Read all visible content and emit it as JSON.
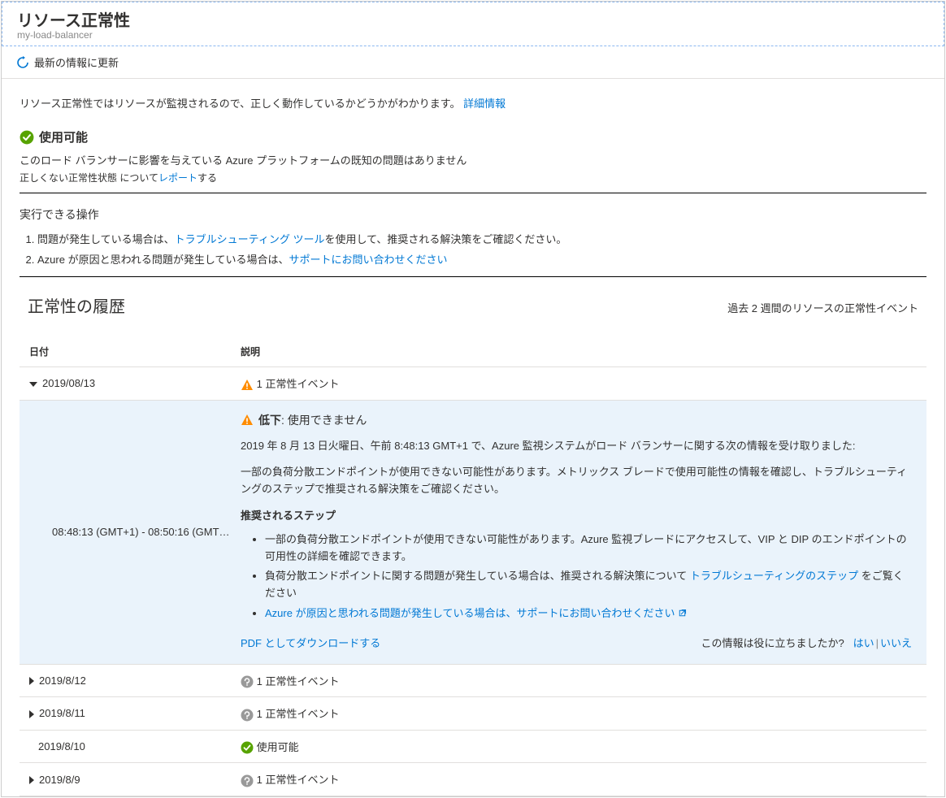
{
  "header": {
    "title": "リソース正常性",
    "subtitle": "my-load-balancer"
  },
  "cmdbar": {
    "refresh": "最新の情報に更新"
  },
  "intro": {
    "text": "リソース正常性ではリソースが監視されるので、正しく動作しているかどうかがわかります。",
    "link": "詳細情報"
  },
  "status": {
    "label": "使用可能",
    "desc": "このロード バランサーに影響を与えている Azure プラットフォームの既知の問題はありません",
    "wrong_prefix": "正しくない正常性状態 について",
    "wrong_link": "レポート",
    "wrong_suffix": "する"
  },
  "actions": {
    "title": "実行できる操作",
    "items": [
      {
        "pre": "問題が発生している場合は、",
        "link": "トラブルシューティング ツール",
        "post": "を使用して、推奨される解決策をご確認ください。"
      },
      {
        "pre": "Azure が原因と思われる問題が発生している場合は、",
        "link": "サポートにお問い合わせください",
        "post": ""
      }
    ]
  },
  "history": {
    "title": "正常性の履歴",
    "subtitle": "過去 2 週間のリソースの正常性イベント",
    "cols": {
      "date": "日付",
      "desc": "説明"
    },
    "rows": [
      {
        "date": "2019/08/13",
        "desc": "1 正常性イベント",
        "icon": "warn",
        "expanded": true
      },
      {
        "date": "2019/8/12",
        "desc": "1 正常性イベント",
        "icon": "unknown"
      },
      {
        "date": "2019/8/11",
        "desc": "1 正常性イベント",
        "icon": "unknown"
      },
      {
        "date": "2019/8/10",
        "desc": "使用可能",
        "icon": "ok",
        "nocaret": true
      },
      {
        "date": "2019/8/9",
        "desc": "1 正常性イベント",
        "icon": "unknown"
      }
    ]
  },
  "detail": {
    "time": "08:48:13 (GMT+1) - 08:50:16 (GMT…",
    "status_label": "低下",
    "status_text": ": 使用できません",
    "line1": "2019 年 8 月 13 日火曜日、午前 8:48:13 GMT+1 で、Azure 監視システムがロード バランサーに関する次の情報を受け取りました:",
    "line2": "一部の負荷分散エンドポイントが使用できない可能性があります。メトリックス ブレードで使用可能性の情報を確認し、トラブルシューティングのステップで推奨される解決策をご確認ください。",
    "steps_title": "推奨されるステップ",
    "steps": [
      {
        "text": "一部の負荷分散エンドポイントが使用できない可能性があります。Azure 監視ブレードにアクセスして、VIP と DIP のエンドポイントの可用性の詳細を確認できます。"
      },
      {
        "pre": "負荷分散エンドポイントに関する問題が発生している場合は、推奨される解決策について ",
        "link": "トラブルシューティングのステップ",
        "post": " をご覧ください"
      },
      {
        "link_full": "Azure が原因と思われる問題が発生している場合は、サポートにお問い合わせください",
        "external": true
      }
    ],
    "pdf": "PDF としてダウンロードする",
    "helpful_q": "この情報は役に立ちましたか?",
    "yes": "はい",
    "no": "いいえ"
  }
}
